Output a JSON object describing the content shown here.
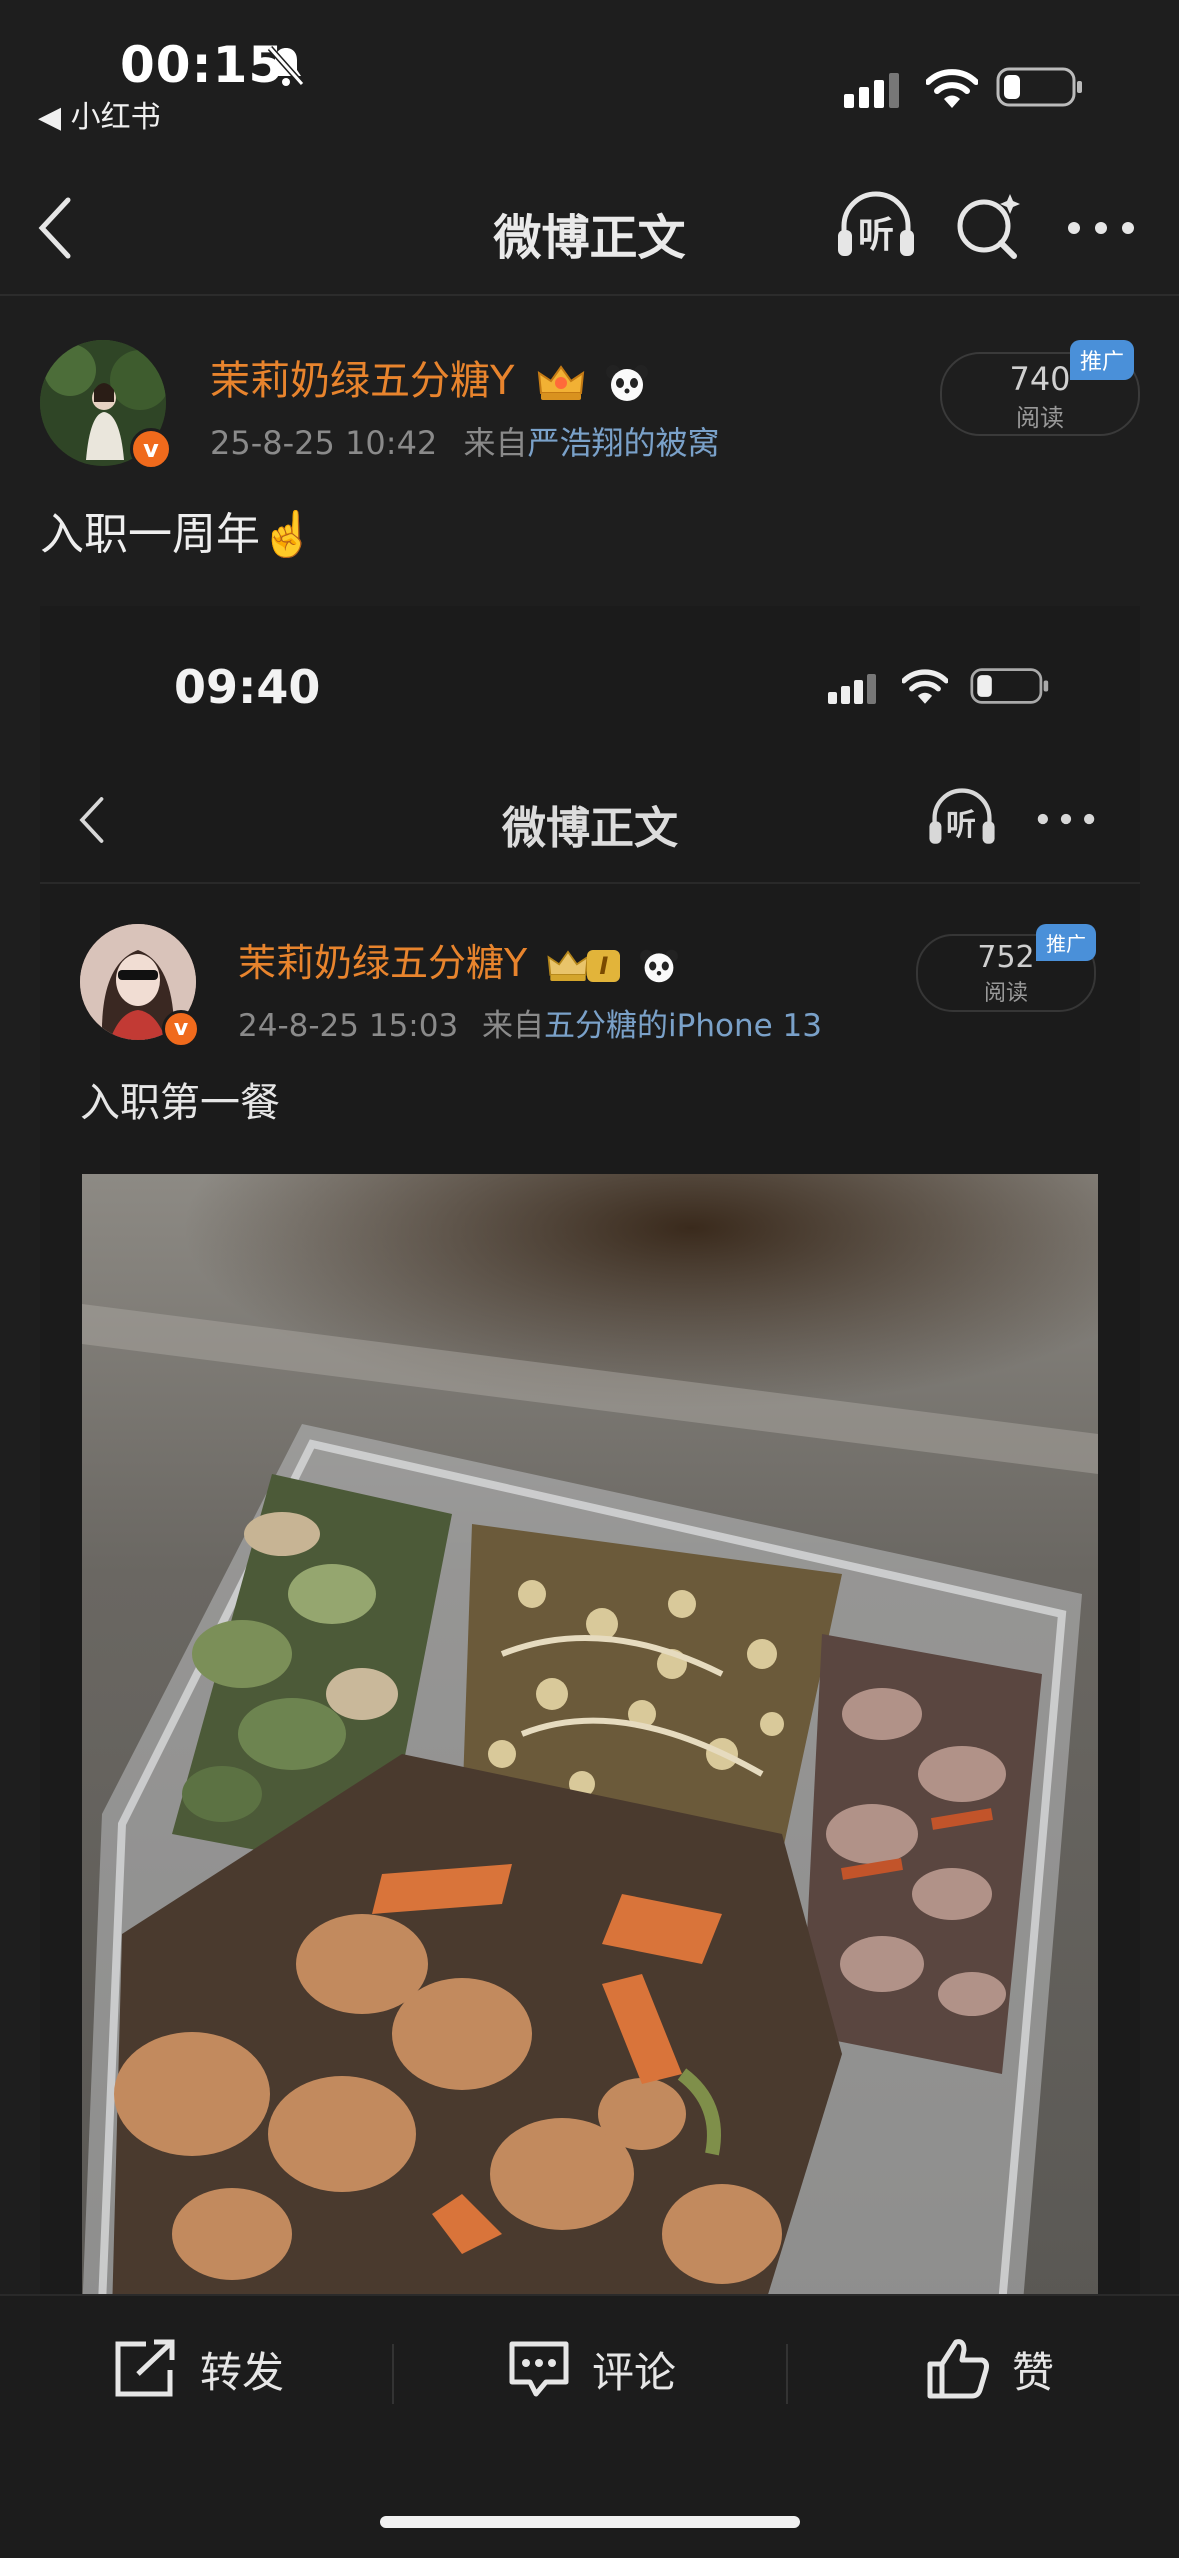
{
  "status_bar": {
    "time": "00:15",
    "back_app": "◀ 小红书"
  },
  "nav": {
    "title": "微博正文",
    "listen_label": "听"
  },
  "post": {
    "username": "茉莉奶绿五分糖Y",
    "date": "25-8-25 10:42",
    "source_prefix": "来自",
    "source": "严浩翔的被窝",
    "reads_count": "740",
    "reads_label": "阅读",
    "promo_label": "推广",
    "text": "入职一周年☝️"
  },
  "embedded": {
    "time": "09:40",
    "nav_title": "微博正文",
    "listen_label": "听",
    "username": "茉莉奶绿五分糖Y",
    "badge_letter": "I",
    "date": "24-8-25 15:03",
    "source_prefix": "来自",
    "source": "五分糖的iPhone 13",
    "reads_count": "752",
    "reads_label": "阅读",
    "promo_label": "推广",
    "text": "入职第一餐"
  },
  "actions": {
    "repost": "转发",
    "comment": "评论",
    "like": "赞"
  },
  "colors": {
    "accent_username": "#e8842d",
    "link": "#7aa1c9",
    "promo": "#4a90d9",
    "vip_badge": "#f06a1c"
  }
}
